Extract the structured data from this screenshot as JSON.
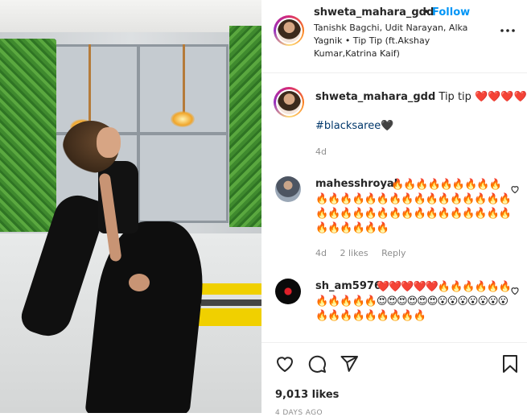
{
  "post": {
    "username": "shweta_mahara_gdd",
    "separator": "•",
    "follow_label": "Follow",
    "song_info": "Tanishk Bagchi, Udit Narayan, Alka Yagnik • Tip Tip (ft.Akshay Kumar,Katrina Kaif)",
    "more_icon": "more-options-icon"
  },
  "caption": {
    "username": "shweta_mahara_gdd",
    "text": "Tip tip",
    "hearts": "❤️❤️❤️❤️",
    "hashtag": "#blacksaree",
    "hashtag_emoji": "🖤",
    "age": "4d"
  },
  "comments": [
    {
      "username": "mahesshroyal",
      "text": "🔥🔥🔥🔥🔥🔥🔥🔥🔥🔥🔥🔥🔥🔥🔥🔥🔥🔥🔥🔥🔥🔥🔥🔥🔥🔥🔥🔥🔥🔥🔥🔥🔥🔥🔥🔥🔥🔥🔥🔥🔥🔥🔥🔥🔥🔥🔥",
      "age": "4d",
      "likes": "2 likes",
      "reply": "Reply"
    },
    {
      "username": "sh_am5976",
      "text": "❤️❤️❤️❤️❤️🔥🔥🔥🔥🔥🔥🔥🔥🔥🔥🔥😍😍😍😍😍😍😮😮😮😮😮😮😮🔥🔥🔥🔥🔥🔥🔥🔥🔥"
    }
  ],
  "actions": {
    "like_icon": "heart-icon",
    "comment_icon": "comment-icon",
    "share_icon": "share-icon",
    "save_icon": "bookmark-icon"
  },
  "likes": "9,013 likes",
  "timestamp": "4 DAYS AGO"
}
